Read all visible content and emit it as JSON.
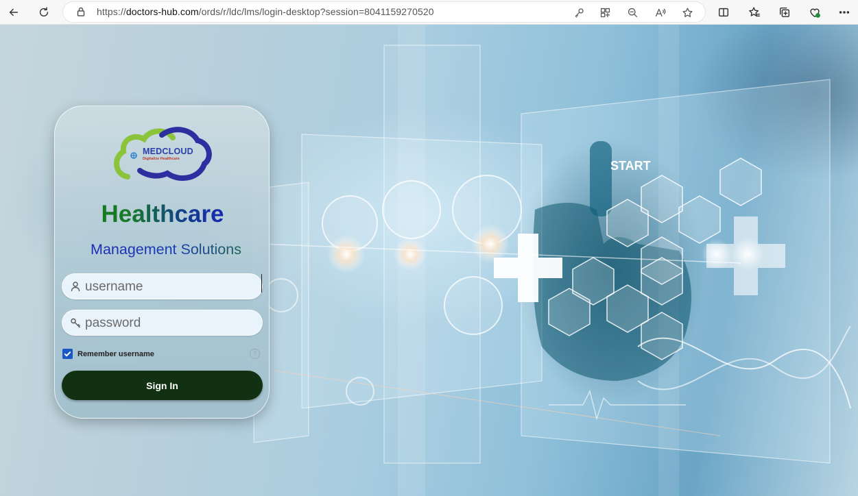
{
  "browser": {
    "url_prefix": "https://",
    "url_host": "doctors-hub.com",
    "url_path": "/ords/r/ldc/lms/login-desktop?session=8041159270520",
    "icons": {
      "back": "back-arrow-icon",
      "refresh": "refresh-icon",
      "lock": "lock-icon",
      "key": "key-icon",
      "apps": "apps-icon",
      "zoom": "zoom-out-icon",
      "read_aloud": "read-aloud-icon",
      "favorite": "star-icon",
      "split": "split-screen-icon",
      "favorites": "favorites-icon",
      "collections": "collections-icon",
      "performance": "performance-icon",
      "more": "more-icon"
    }
  },
  "login": {
    "logo_text": "MEDCLOUD",
    "logo_tagline": "Digitalize Healthcare",
    "title": "Healthcare",
    "subtitle": "Management Solutions",
    "username_placeholder": "username",
    "password_placeholder": "password",
    "remember_label": "Remember username",
    "remember_checked": true,
    "help_glyph": "?",
    "signin_label": "Sign In"
  },
  "colors": {
    "signin_bg": "#123112",
    "title_green": "#137a18",
    "title_blue": "#1d10d8",
    "checkbox": "#1a56c4"
  }
}
